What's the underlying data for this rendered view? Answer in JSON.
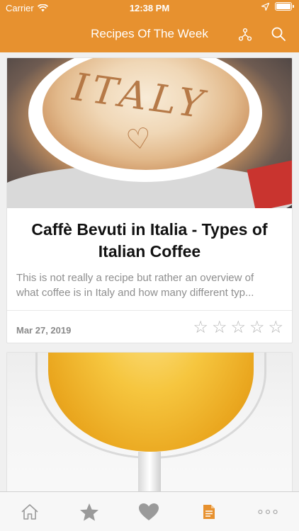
{
  "status_bar": {
    "carrier": "Carrier",
    "time": "12:38 PM"
  },
  "nav": {
    "title": "Recipes Of The Week"
  },
  "colors": {
    "accent": "#e7912f",
    "tab_active": "#e7912f",
    "tab_inactive": "#9a9a9a"
  },
  "recipes": [
    {
      "image_text": "ITALY",
      "title": "Caffè Bevuti in Italia - Types of Italian Coffee",
      "description_line1": "This is not really a recipe but rather an overview of",
      "description_line2": "what coffee is in Italy and how many different typ...",
      "date": "Mar 27, 2019",
      "rating": 0,
      "max_rating": 5
    }
  ],
  "tab_bar": {
    "tabs": [
      {
        "icon": "home-icon",
        "active": false
      },
      {
        "icon": "star-icon",
        "active": false
      },
      {
        "icon": "heart-icon",
        "active": false
      },
      {
        "icon": "document-icon",
        "active": true
      },
      {
        "icon": "more-icon",
        "active": false
      }
    ]
  }
}
